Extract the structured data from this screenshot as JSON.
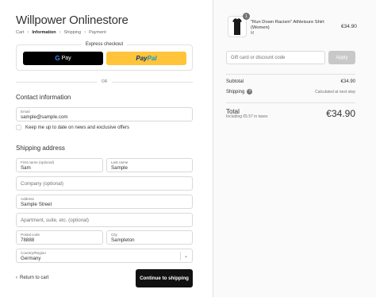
{
  "store": {
    "name": "Willpower Onlinestore"
  },
  "breadcrumb": [
    {
      "label": "Cart"
    },
    {
      "label": "Information"
    },
    {
      "label": "Shipping"
    },
    {
      "label": "Payment"
    }
  ],
  "express": {
    "title": "Express checkout",
    "gpay_g": "G",
    "gpay_label": "Pay",
    "paypal_pay": "Pay",
    "paypal_pal": "Pal"
  },
  "or_label": "OR",
  "contact": {
    "title": "Contact information",
    "email_label": "Email",
    "email_value": "sample@sample.com",
    "newsletter_label": "Keep me up to date on news and exclusive offers"
  },
  "shipping": {
    "title": "Shipping address",
    "first_name_label": "First name (optional)",
    "first_name_value": "Sam",
    "last_name_label": "Last name",
    "last_name_value": "Sample",
    "company_placeholder": "Company (optional)",
    "address_label": "Address",
    "address_value": "Sample Street",
    "apartment_placeholder": "Apartment, suite, etc. (optional)",
    "postal_label": "Postal code",
    "postal_value": "78888",
    "city_label": "City",
    "city_value": "Sampleton",
    "country_label": "Country/Region",
    "country_value": "Germany"
  },
  "actions": {
    "back_label": "Return to cart",
    "continue_label": "Continue to shipping"
  },
  "order": {
    "item": {
      "qty": "1",
      "name": "\"Run Down Racism\" Athleisure Shirt (Women)",
      "variant": "M",
      "price": "€34.90"
    },
    "discount_placeholder": "Gift card or discount code",
    "apply_label": "Apply",
    "subtotal_label": "Subtotal",
    "subtotal_value": "€34.90",
    "shipping_label": "Shipping",
    "shipping_value": "Calculated at next step",
    "total_label": "Total",
    "taxes_note": "Including €5.57 in taxes",
    "total_value": "€34.90"
  },
  "icons": {
    "chevron_right": "›",
    "chevron_left": "‹",
    "chevron_down": "⌄",
    "help": "?"
  }
}
